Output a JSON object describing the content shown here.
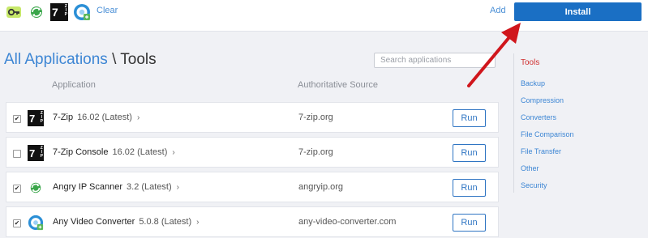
{
  "toolbar": {
    "selected_icons": [
      "key-icon",
      "angry-ip-scanner-icon",
      "7zip-icon",
      "any-video-converter-icon"
    ],
    "clear_label": "Clear",
    "add_label": "Add",
    "install_label": "Install"
  },
  "breadcrumb": {
    "root": "All Applications",
    "separator": "\\",
    "current": "Tools"
  },
  "search": {
    "placeholder": "Search applications",
    "value": ""
  },
  "columns": {
    "application": "Application",
    "source": "Authoritative Source"
  },
  "apps": [
    {
      "name": "7-Zip",
      "version": "16.02 (Latest)",
      "source": "7-zip.org",
      "checked": true,
      "icon": "7zip-icon",
      "action": "Run"
    },
    {
      "name": "7-Zip Console",
      "version": "16.02 (Latest)",
      "source": "7-zip.org",
      "checked": false,
      "icon": "7zip-icon",
      "action": "Run"
    },
    {
      "name": "Angry IP Scanner",
      "version": "3.2 (Latest)",
      "source": "angryip.org",
      "checked": true,
      "icon": "angry-ip-scanner-icon",
      "action": "Run"
    },
    {
      "name": "Any Video Converter",
      "version": "5.0.8 (Latest)",
      "source": "any-video-converter.com",
      "checked": true,
      "icon": "any-video-converter-icon",
      "action": "Run"
    }
  ],
  "categories": {
    "active": "Tools",
    "items": [
      "Backup",
      "Compression",
      "Converters",
      "File Comparison",
      "File Transfer",
      "Other",
      "Security"
    ]
  },
  "colors": {
    "accent": "#1a6fc4",
    "link": "#3d86d4",
    "active_category": "#d03030",
    "annotation_arrow": "#d0161c"
  }
}
